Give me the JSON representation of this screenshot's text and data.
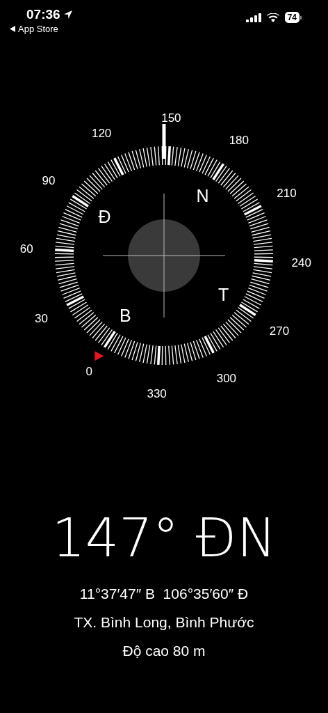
{
  "status_bar": {
    "time": "07:36",
    "back_link": "App Store",
    "battery": "74"
  },
  "compass": {
    "degree_labels": [
      "0",
      "30",
      "60",
      "90",
      "120",
      "150",
      "180",
      "210",
      "240",
      "270",
      "300",
      "330"
    ],
    "cardinals": [
      "B",
      "Đ",
      "N",
      "T"
    ]
  },
  "readout": {
    "heading": "147° ĐN",
    "coordinates": "11°37′47″ B  106°35′60″ Đ",
    "place": "TX. Bình Long, Bình Phước",
    "altitude": "Độ cao 80 m"
  }
}
